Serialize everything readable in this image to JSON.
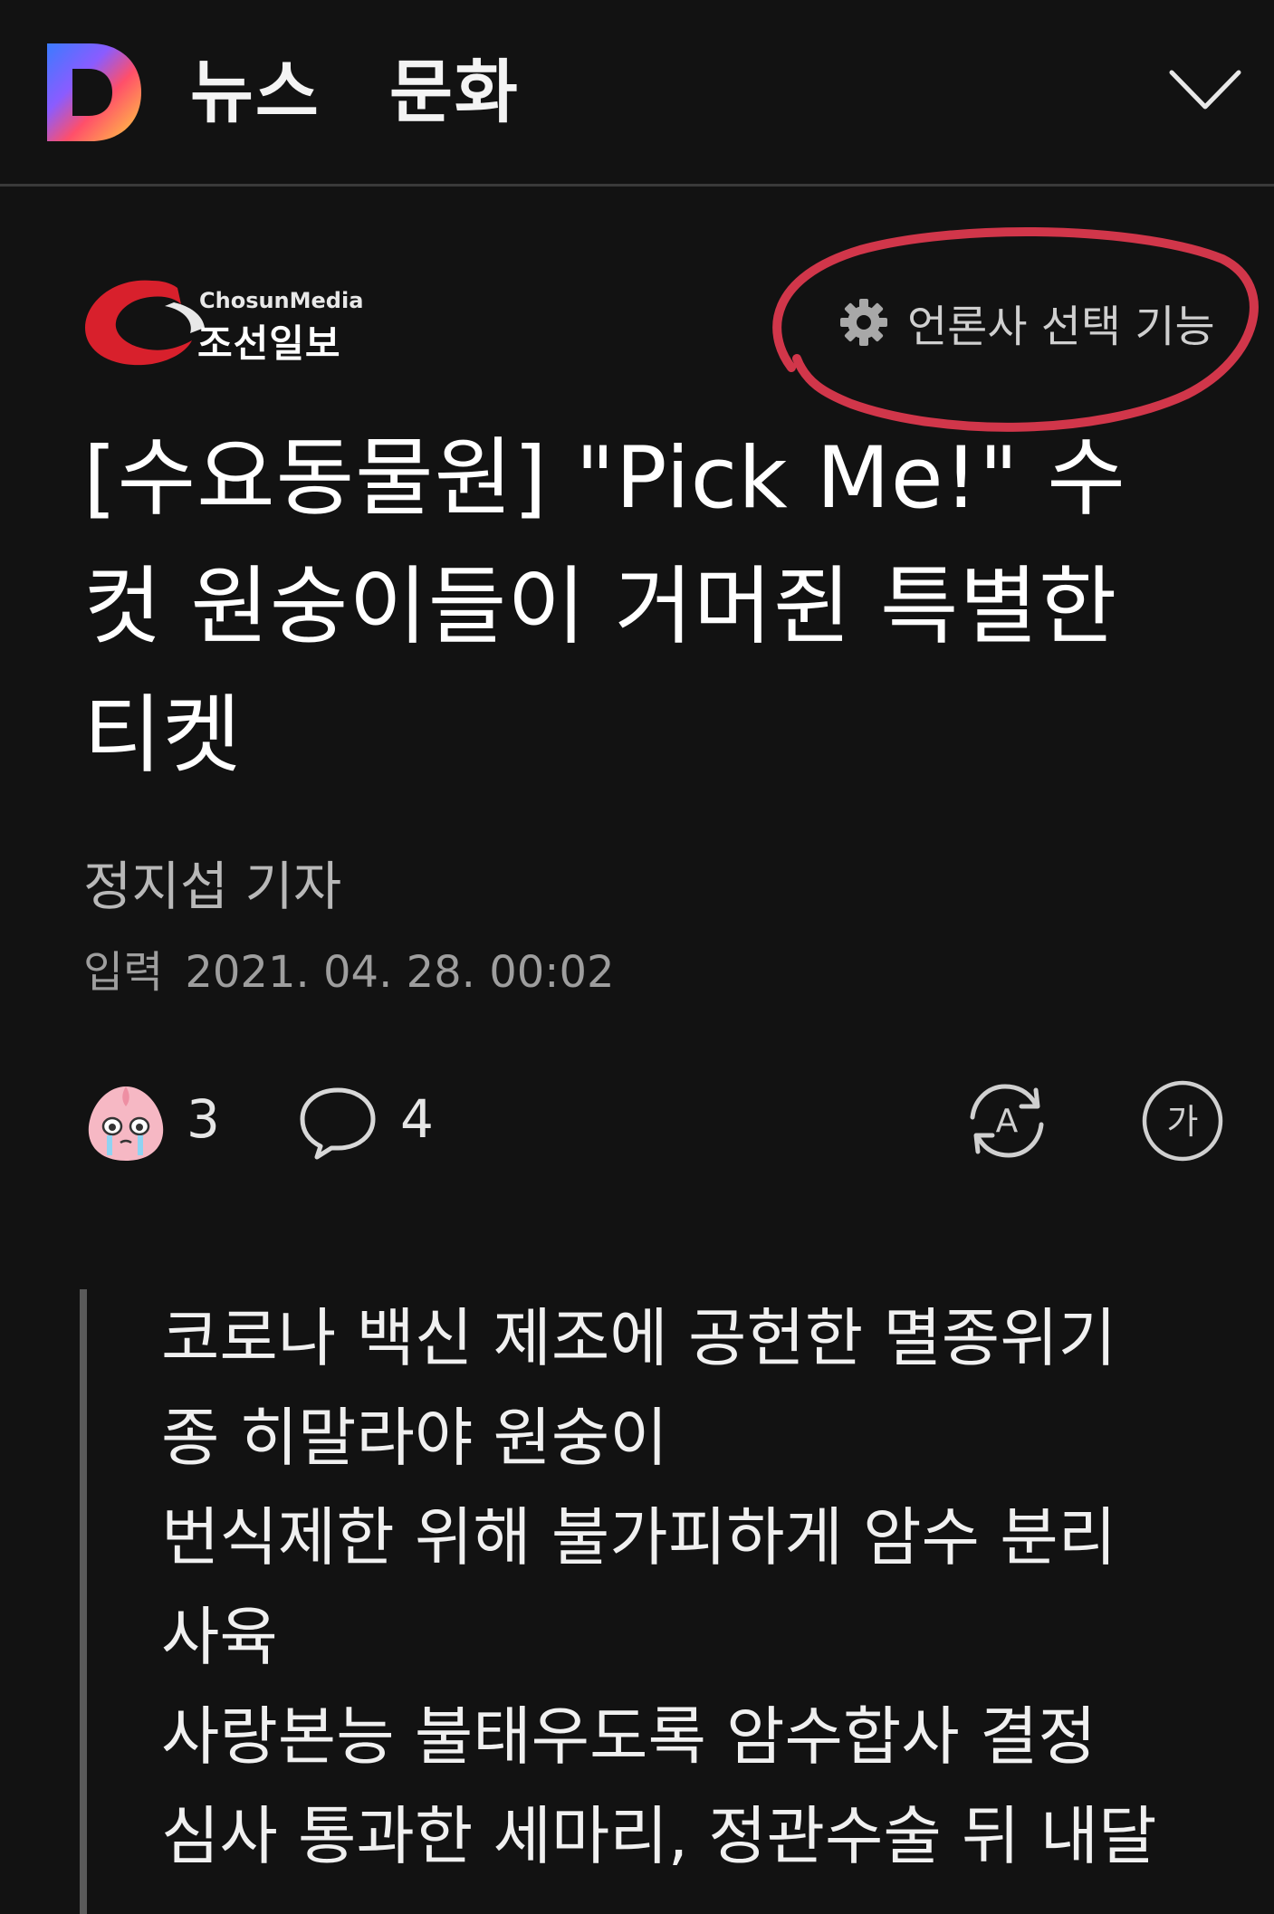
{
  "header": {
    "logo_letter": "D",
    "section": "뉴스",
    "category": "문화",
    "menu_icon": "chevron-down-icon"
  },
  "press": {
    "sub_brand": "ChosunMedia",
    "name": "조선일보",
    "select_label": "언론사 선택 기능",
    "select_icon": "gear-icon",
    "highlight_color": "#e23a4f"
  },
  "article": {
    "headline_lines": [
      "[수요동물원] \"Pick Me!\" 수",
      "컷 원숭이들이 거머쥔 특별한",
      "티켓"
    ],
    "reporter": "정지섭 기자",
    "date_label": "입력",
    "date_value": "2021. 04. 28. 00:02"
  },
  "reactions": {
    "emoji_count": "3",
    "comment_count": "4",
    "emoji_icon": "crying-peach-icon",
    "comment_icon": "comment-bubble-icon",
    "translate_icon": "translate-icon",
    "font_size_icon": "font-size-icon",
    "font_size_glyph": "가",
    "translate_glyph": "A"
  },
  "summary": {
    "lines": [
      "코로나 백신 제조에 공헌한 멸종위기",
      "종 히말라야 원숭이",
      "번식제한 위해 불가피하게 암수 분리",
      "사육",
      "사랑본능 불태우도록 암수합사 결정",
      "심사 통과한 세마리, 정관수술 뒤 내달"
    ]
  }
}
